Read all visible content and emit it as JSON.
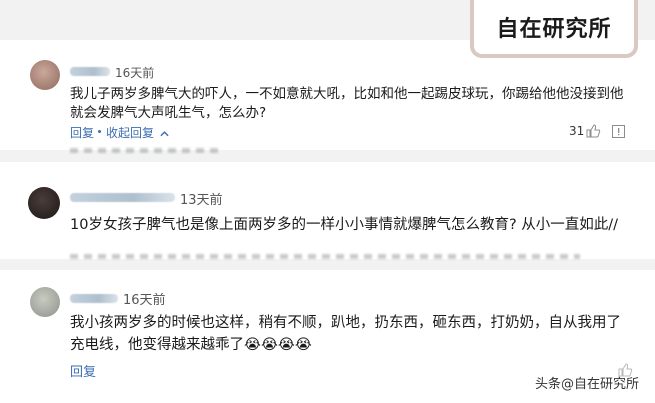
{
  "brand": {
    "title": "自在研究所"
  },
  "watermark": "头条@自在研究所",
  "comments": [
    {
      "time": "16天前",
      "text": "我儿子两岁多脾气大的吓人，一不如意就大吼，比如和他一起踢皮球玩，你踢给他他没接到他就会发脾气大声吼生气，怎么办?",
      "reply": "回复",
      "collapse": "收起回复",
      "likes": "31"
    },
    {
      "time": "13天前",
      "text": "10岁女孩子脾气也是像上面两岁多的一样小小事情就爆脾气怎么教育? 从小一直如此//"
    },
    {
      "time": "16天前",
      "text": "我小孩两岁多的时候也这样，稍有不顺，趴地，扔东西，砸东西，打奶奶，自从我用了充电线，他变得越来越乖了😭😭😭😭",
      "reply": "回复"
    }
  ],
  "icons": [
    "chevron-up-icon",
    "thumb-up-icon",
    "report-icon"
  ],
  "colors": {
    "link": "#3b6db0",
    "brand_border": "#d9c9c2"
  }
}
